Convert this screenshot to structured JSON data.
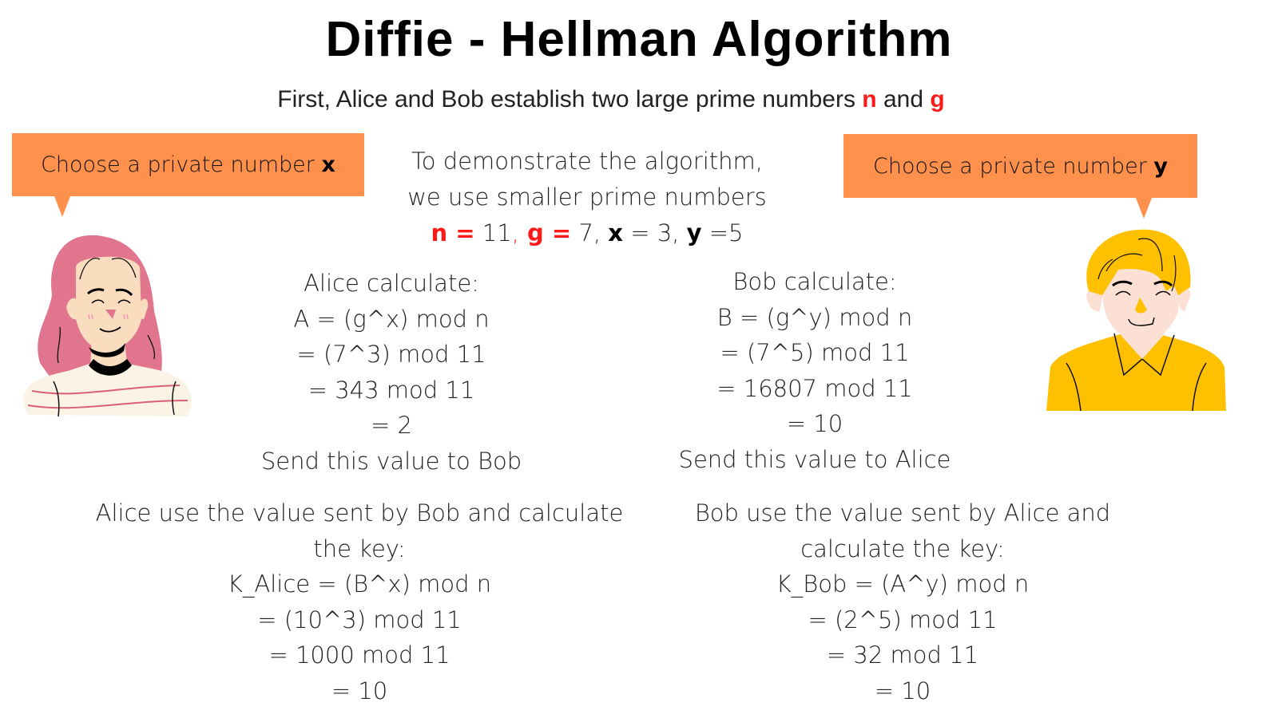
{
  "title": "Diffie - Hellman Algorithm",
  "subtitle": {
    "text_before": "First, Alice and Bob establish two large prime numbers ",
    "var_n": "n",
    "text_mid": " and ",
    "var_g": "g"
  },
  "colors": {
    "bubble": "#ff914d",
    "highlight_red": "#ff1a1a",
    "alice_hair": "#e0758d",
    "alice_skin": "#fadcbf",
    "alice_shirt": "#fbf3e6",
    "bob_hair": "#ffc000",
    "bob_skin": "#fde0d4",
    "bob_shirt": "#ffc000"
  },
  "bubbles": {
    "alice": {
      "text": "Choose a private number ",
      "var": "x"
    },
    "bob": {
      "text": "Choose a private number ",
      "var": "y"
    }
  },
  "demo": {
    "line1": "To demonstrate the algorithm,",
    "line2": "we use smaller prime numbers",
    "n_label": "n =",
    "n_value": " 11",
    "sep1": ",",
    "g_label": " g =",
    "g_value": " 7, ",
    "x_label": "x",
    "x_value": " = 3, ",
    "y_label": "y",
    "y_value": " =5"
  },
  "alice_calc": {
    "lines": [
      "Alice calculate:",
      "A = (g^x) mod n",
      "= (7^3) mod 11",
      " = 343 mod 11",
      "= 2",
      "Send this value to Bob"
    ]
  },
  "bob_calc": {
    "lines": [
      "Bob calculate:",
      "B = (g^y) mod n",
      "= (7^5) mod 11",
      " = 16807 mod 11",
      "= 10",
      "Send this value to Alice"
    ]
  },
  "alice_key": {
    "lines": [
      "Alice use the value sent by Bob and calculate",
      "the key:",
      "K_Alice = (B^x) mod n",
      "= (10^3) mod 11",
      " = 1000 mod 11",
      "= 10"
    ]
  },
  "bob_key": {
    "lines": [
      "Bob use the value sent by Alice and",
      "calculate the key:",
      "K_Bob = (A^y) mod n",
      "= (2^5) mod 11",
      "= 32 mod 11",
      "= 10"
    ]
  },
  "characters": {
    "alice": "alice-avatar-illustration",
    "bob": "bob-avatar-illustration"
  }
}
